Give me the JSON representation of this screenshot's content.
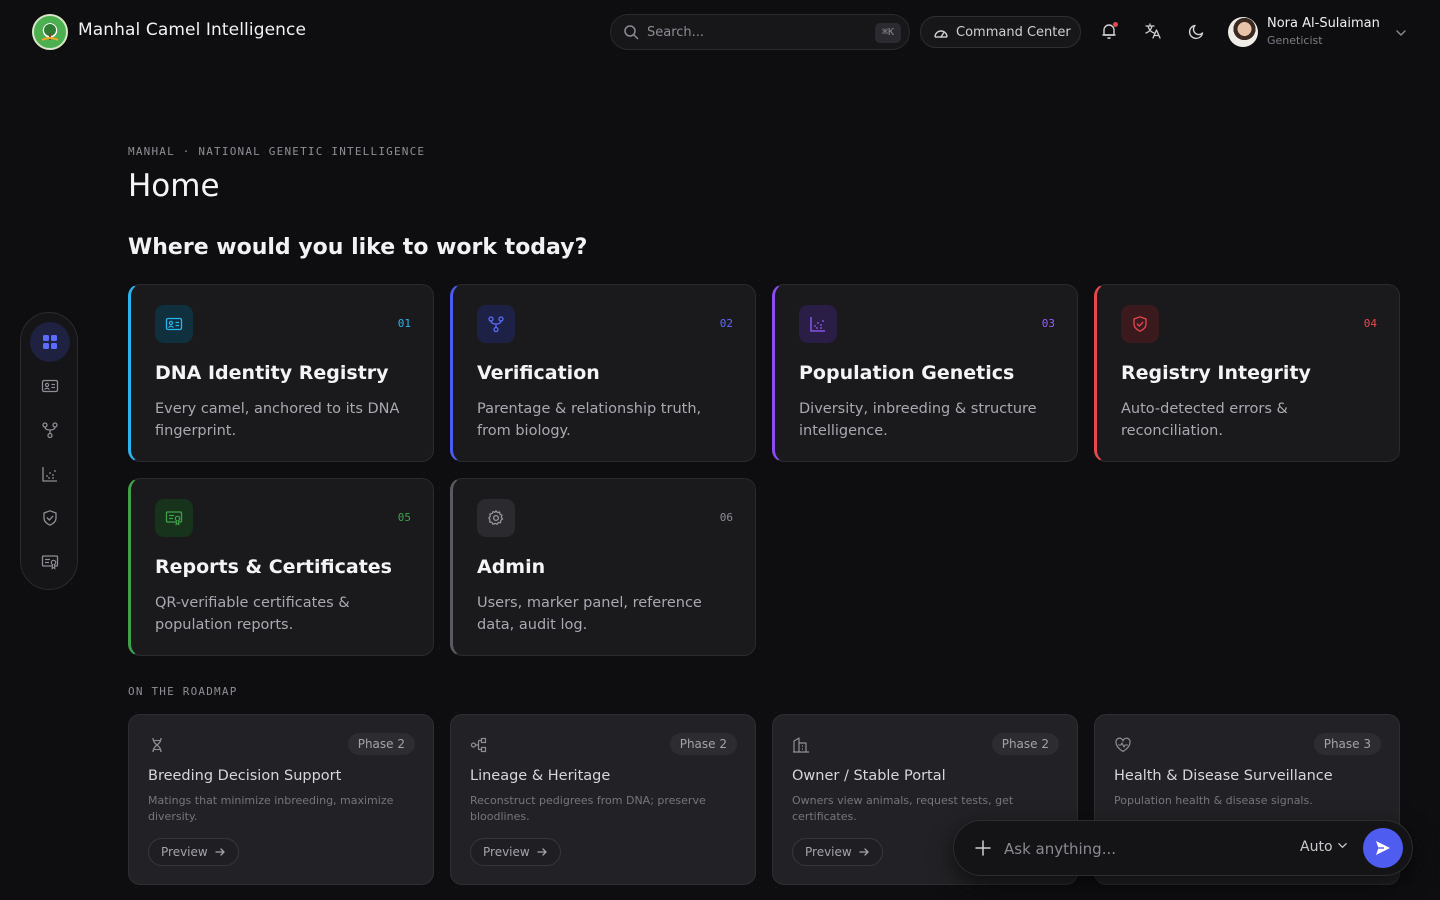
{
  "app": {
    "title": "Manhal Camel Intelligence"
  },
  "search": {
    "placeholder": "Search...",
    "shortcut": "⌘K"
  },
  "header": {
    "command_center": "Command Center"
  },
  "user": {
    "name": "Nora Al-Sulaiman",
    "role": "Geneticist"
  },
  "page": {
    "eyebrow": "MANHAL · NATIONAL GENETIC INTELLIGENCE",
    "title": "Home",
    "question": "Where would you like to work today?"
  },
  "sidebar": {
    "items": [
      {
        "icon": "grid-icon",
        "active": true
      },
      {
        "icon": "id-card-icon"
      },
      {
        "icon": "branch-icon"
      },
      {
        "icon": "scatter-chart-icon"
      },
      {
        "icon": "shield-check-icon"
      },
      {
        "icon": "certificate-icon"
      }
    ]
  },
  "modules": [
    {
      "num": "01",
      "title": "DNA Identity Registry",
      "desc": "Every camel, anchored to its DNA fingerprint.",
      "color": "#2bb5f0",
      "icon": "id-card-icon"
    },
    {
      "num": "02",
      "title": "Verification",
      "desc": "Parentage & relationship truth, from biology.",
      "color": "#4b5cf0",
      "icon": "branch-icon"
    },
    {
      "num": "03",
      "title": "Population Genetics",
      "desc": "Diversity, inbreeding & structure intelligence.",
      "color": "#8a4cf0",
      "icon": "scatter-chart-icon"
    },
    {
      "num": "04",
      "title": "Registry Integrity",
      "desc": "Auto-detected errors & reconciliation.",
      "color": "#e5484d",
      "icon": "shield-check-icon"
    },
    {
      "num": "05",
      "title": "Reports & Certificates",
      "desc": "QR-verifiable certificates & population reports.",
      "color": "#3fa14a",
      "icon": "certificate-icon"
    },
    {
      "num": "06",
      "title": "Admin",
      "desc": "Users, marker panel, reference data, audit log.",
      "color": "#6b6b73",
      "icon": "gear-icon"
    }
  ],
  "roadmap": {
    "label": "ON THE ROADMAP",
    "items": [
      {
        "phase": "Phase 2",
        "title": "Breeding Decision Support",
        "desc": "Matings that minimize inbreeding, maximize diversity.",
        "action": "Preview",
        "icon": "dna-icon"
      },
      {
        "phase": "Phase 2",
        "title": "Lineage & Heritage",
        "desc": "Reconstruct pedigrees from DNA; preserve bloodlines.",
        "action": "Preview",
        "icon": "pedigree-icon"
      },
      {
        "phase": "Phase 2",
        "title": "Owner / Stable Portal",
        "desc": "Owners view animals, request tests, get certificates.",
        "action": "Preview",
        "icon": "building-icon"
      },
      {
        "phase": "Phase 3",
        "title": "Health & Disease Surveillance",
        "desc": "Population health & disease signals.",
        "action": "",
        "icon": "heart-pulse-icon"
      }
    ]
  },
  "ask": {
    "placeholder": "Ask anything...",
    "mode": "Auto"
  },
  "colors": {
    "accent": "#4f5cf0",
    "background": "#0e0e10",
    "card": "#1a1a1d"
  }
}
